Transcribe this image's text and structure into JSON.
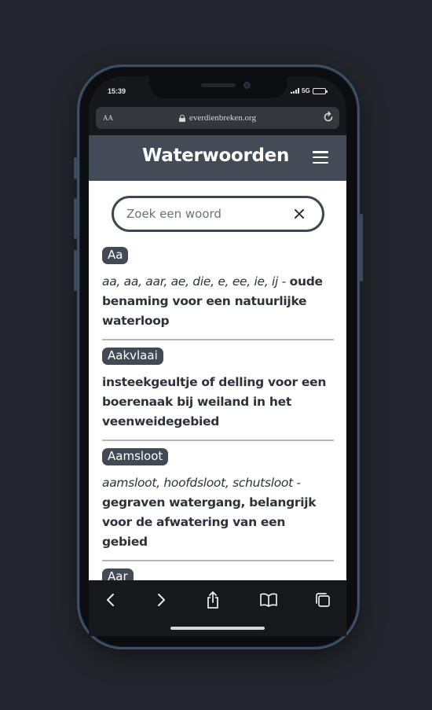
{
  "status_bar": {
    "time": "15:39",
    "network": "5G"
  },
  "browser": {
    "text_size_label": "AA",
    "url": "everdienbreken.org"
  },
  "app": {
    "title": "Waterwoorden"
  },
  "search": {
    "placeholder": "Zoek een woord",
    "value": ""
  },
  "entries": [
    {
      "term": "Aa",
      "variants": "aa, aa, aar, ae, die, e, ee, ie, ij",
      "separator": " - ",
      "meaning": "oude benaming voor een natuurlijke waterloop"
    },
    {
      "term": "Aakvlaai",
      "variants": "",
      "separator": "",
      "meaning": "insteekgeultje of delling voor een boerenaak bij weiland in het veenweidegebied"
    },
    {
      "term": "Aamsloot",
      "variants": "aamsloot, hoofdsloot, schutsloot",
      "separator": " - ",
      "meaning": "gegraven watergang, belangrijk voor de afwatering van een gebied"
    },
    {
      "term": "Aar",
      "variants": "",
      "separator": "",
      "meaning": ""
    }
  ],
  "toolbar": {
    "icons": [
      "back-icon",
      "forward-icon",
      "share-icon",
      "bookmarks-icon",
      "tabs-icon"
    ]
  },
  "colors": {
    "background": "#23272d",
    "header": "#434b57",
    "tag": "#424a56",
    "text": "#2d323a"
  }
}
